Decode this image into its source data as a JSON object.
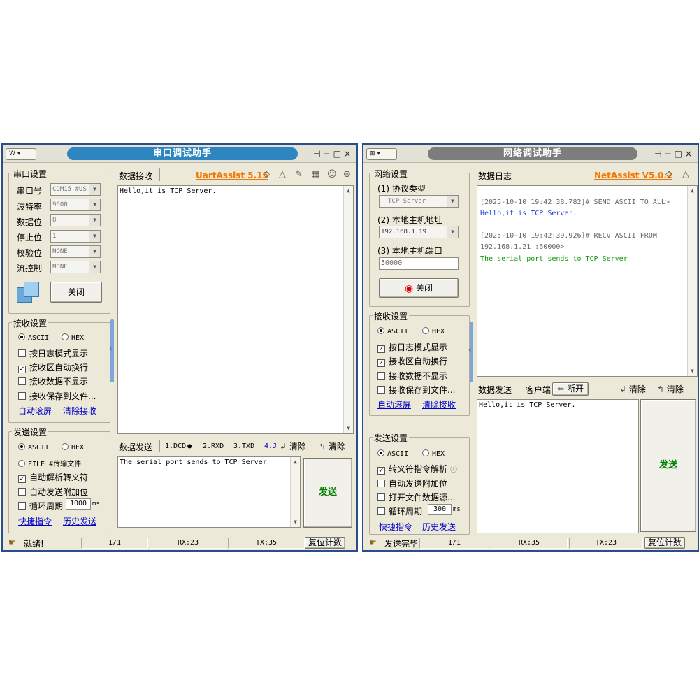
{
  "uart": {
    "title": "串口调试助手",
    "brand": "UartAssist 5.15",
    "serial_group": "串口设置",
    "fields": [
      {
        "label": "串口号",
        "value": "COM15 #US"
      },
      {
        "label": "波特率",
        "value": "9600"
      },
      {
        "label": "数据位",
        "value": "8"
      },
      {
        "label": "停止位",
        "value": "1"
      },
      {
        "label": "校验位",
        "value": "NONE"
      },
      {
        "label": "流控制",
        "value": "NONE"
      }
    ],
    "close_button": "关闭",
    "recv_group": "接收设置",
    "recv_radio_ascii": "ASCII",
    "recv_radio_hex": "HEX",
    "recv_checks": [
      {
        "label": "按日志模式显示",
        "checked": false
      },
      {
        "label": "接收区自动换行",
        "checked": true
      },
      {
        "label": "接收数据不显示",
        "checked": false
      },
      {
        "label": "接收保存到文件...",
        "checked": false
      }
    ],
    "recv_links": [
      "自动滚屏",
      "清除接收"
    ],
    "send_group": "发送设置",
    "send_radio_ascii": "ASCII",
    "send_radio_hex": "HEX",
    "send_radio_file": "FILE #传输文件",
    "send_checks": [
      {
        "label": "自动解析转义符",
        "checked": true
      },
      {
        "label": "自动发送附加位",
        "checked": false
      }
    ],
    "loop_label": "循环周期",
    "loop_value": "1000",
    "loop_unit": "ms",
    "send_links": [
      "快捷指令",
      "历史发送"
    ],
    "recv_tab": "数据接收",
    "recv_text": "Hello,it is TCP Server.",
    "send_tab": "数据发送",
    "pins": [
      "1.DCD",
      "2.RXD",
      "3.TXD",
      "4.J"
    ],
    "clear1": "清除",
    "clear2": "清除",
    "send_text": "The serial port sends to TCP Server",
    "send_button": "发送",
    "status_text": "就绪!",
    "status_page": "1/1",
    "status_rx": "RX:23",
    "status_tx": "TX:35",
    "reset_button": "复位计数"
  },
  "net": {
    "title": "网络调试助手",
    "brand": "NetAssist V5.0.2",
    "net_group": "网络设置",
    "proto_label": "(1) 协议类型",
    "proto_value": "TCP Server",
    "host_label": "(2) 本地主机地址",
    "host_value": "192.168.1.19",
    "port_label": "(3) 本地主机端口",
    "port_value": "50000",
    "close_button": "关闭",
    "recv_group": "接收设置",
    "recv_radio_ascii": "ASCII",
    "recv_radio_hex": "HEX",
    "recv_checks": [
      {
        "label": "按日志模式显示",
        "checked": true
      },
      {
        "label": "接收区自动换行",
        "checked": true
      },
      {
        "label": "接收数据不显示",
        "checked": false
      },
      {
        "label": "接收保存到文件...",
        "checked": false
      }
    ],
    "recv_links": [
      "自动滚屏",
      "清除接收"
    ],
    "send_group": "发送设置",
    "send_radio_ascii": "ASCII",
    "send_radio_hex": "HEX",
    "send_checks": [
      {
        "label": "转义符指令解析",
        "checked": true
      },
      {
        "label": "自动发送附加位",
        "checked": false
      },
      {
        "label": "打开文件数据源...",
        "checked": false
      }
    ],
    "loop_label": "循环周期",
    "loop_value": "300",
    "loop_unit": "ms",
    "send_links": [
      "快捷指令",
      "历史发送"
    ],
    "log_tab": "数据日志",
    "log_lines": [
      {
        "text": "[2025-10-10 19:42:38.782]# SEND ASCII TO ALL>",
        "color": "#666666"
      },
      {
        "text": "Hello,it is TCP Server.",
        "color": "#1a3fd0"
      },
      {
        "text": "[2025-10-10 19:42:39.926]# RECV ASCII FROM",
        "color": "#666666"
      },
      {
        "text": "192.168.1.21 :60000>",
        "color": "#666666"
      },
      {
        "text": "The serial port sends to TCP Server",
        "color": "#119911"
      }
    ],
    "send_tab": "数据发送",
    "client_tab": "客户端",
    "disconnect": "断开",
    "clear1": "清除",
    "clear2": "清除",
    "send_text": "Hello,it is TCP Server.",
    "send_button": "发送",
    "status_text": "发送完毕",
    "status_page": "1/1",
    "status_rx": "RX:35",
    "status_tx": "TX:23",
    "reset_button": "复位计数"
  }
}
